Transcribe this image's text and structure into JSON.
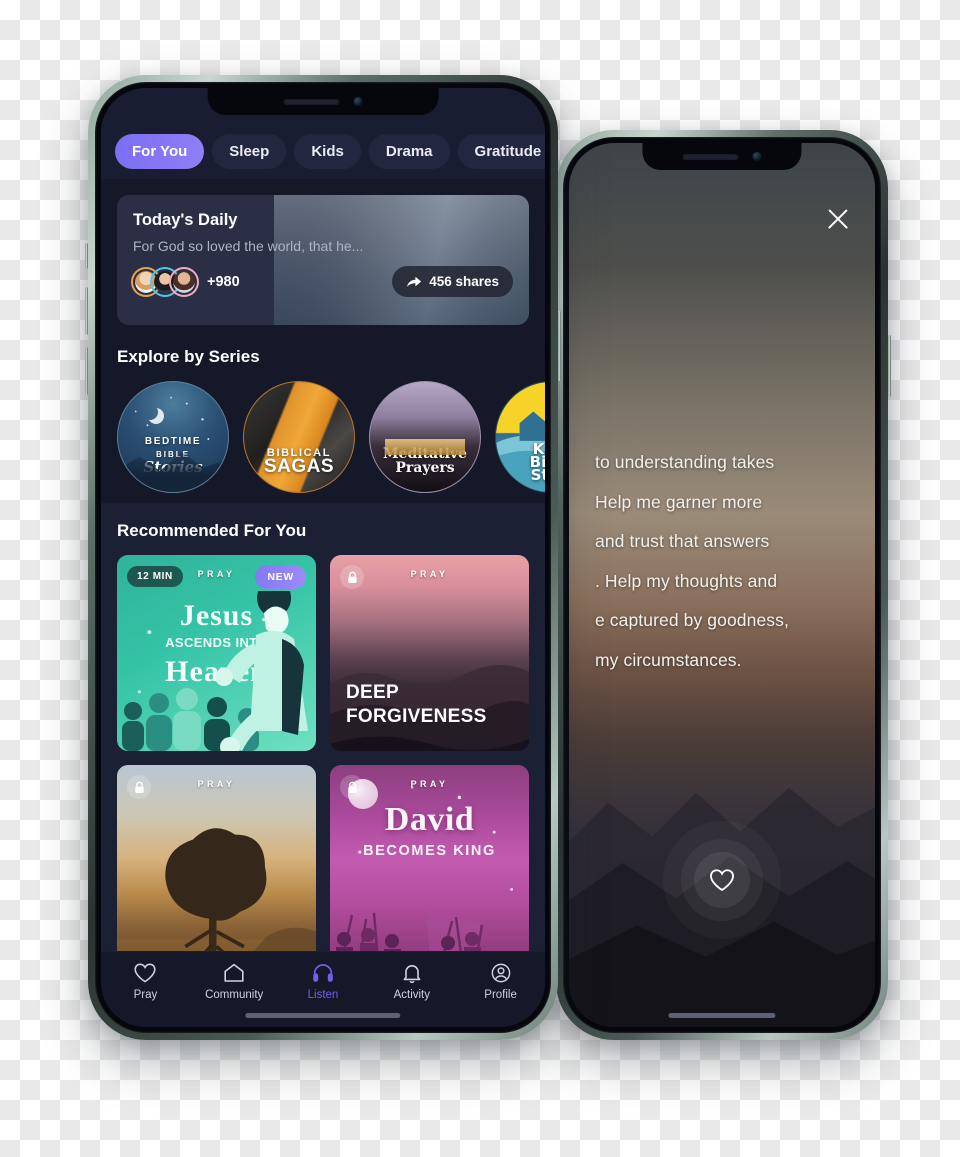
{
  "browse_phone": {
    "tabs": [
      {
        "label": "For You",
        "active": true
      },
      {
        "label": "Sleep",
        "active": false
      },
      {
        "label": "Kids",
        "active": false
      },
      {
        "label": "Drama",
        "active": false
      },
      {
        "label": "Gratitude",
        "active": false
      }
    ],
    "daily": {
      "title": "Today's Daily",
      "verse": "For God so loved the world, that he...",
      "extra_listeners": "+980",
      "shares_label": "456 shares",
      "share_icon": "share-arrow-icon",
      "avatars": [
        "avatar-1",
        "avatar-2",
        "avatar-3"
      ]
    },
    "series_section": {
      "heading": "Explore by Series",
      "items": [
        {
          "line1": "BEDTIME",
          "line2": "BIBLE",
          "line3": "Stories",
          "id": "bedtime-bible-stories"
        },
        {
          "line1": "BIBLICAL",
          "line2": "SAGAS",
          "line3": "",
          "id": "biblical-sagas"
        },
        {
          "line1": "Meditative",
          "line2": "Prayers",
          "line3": "",
          "id": "meditative-prayers"
        },
        {
          "line1": "Kids",
          "line2": "Bible",
          "line3": "Stori",
          "id": "kids-bible-stories"
        }
      ]
    },
    "recommended_section": {
      "heading": "Recommended For You",
      "cards": [
        {
          "id": "jesus-ascends-into-heaven",
          "brand": "PRAY",
          "duration_badge": "12 MIN",
          "new_badge": "NEW",
          "title_line1": "Jesus",
          "title_line2": "ASCENDS INTO",
          "title_line3": "Heaven",
          "locked": false
        },
        {
          "id": "deep-forgiveness",
          "brand": "PRAY",
          "title_line1": "DEEP",
          "title_line2": "FORGIVENESS",
          "locked": true
        },
        {
          "id": "sunrise-tree",
          "brand": "PRAY",
          "locked": true
        },
        {
          "id": "david-becomes-king",
          "brand": "PRAY",
          "title_line1": "David",
          "title_line2": "BECOMES KING",
          "locked": true
        }
      ]
    },
    "bottom_nav": [
      {
        "label": "Pray",
        "icon": "heart-icon",
        "active": false
      },
      {
        "label": "Community",
        "icon": "home-icon",
        "active": false
      },
      {
        "label": "Listen",
        "icon": "headphones-icon",
        "active": true
      },
      {
        "label": "Activity",
        "icon": "bell-icon",
        "active": false
      },
      {
        "label": "Profile",
        "icon": "person-circle-icon",
        "active": false
      }
    ]
  },
  "player_phone": {
    "close_icon": "close-icon",
    "favorite_icon": "heart-icon",
    "prayer_lines": [
      "to understanding takes",
      "Help me garner more",
      "and trust that answers",
      ". Help my thoughts and",
      "e captured by goodness,",
      "my circumstances."
    ]
  },
  "colors": {
    "accent_purple": "#6C63E8",
    "tab_active": "#7A6EF2",
    "app_bg": "#141829",
    "panel_bg": "#1B2035",
    "card_bg": "#222740"
  }
}
